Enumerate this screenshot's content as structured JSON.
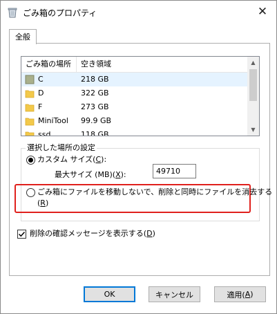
{
  "window": {
    "title": "ごみ箱のプロパティ",
    "close_glyph": "✕"
  },
  "tabs": [
    {
      "label": "全般",
      "selected": true
    }
  ],
  "listview": {
    "columns": [
      "ごみ箱の場所",
      "空き領域"
    ],
    "rows": [
      {
        "name": "C",
        "size": "218 GB",
        "icon": "drive-icon",
        "selected": true
      },
      {
        "name": "D",
        "size": "322 GB",
        "icon": "folder-icon",
        "selected": false
      },
      {
        "name": "F",
        "size": "273 GB",
        "icon": "folder-icon",
        "selected": false
      },
      {
        "name": "MiniTool",
        "size": "99.9 GB",
        "icon": "folder-icon",
        "selected": false
      },
      {
        "name": "ssd",
        "size": "118 GB",
        "icon": "folder-icon",
        "selected": false
      }
    ]
  },
  "settings": {
    "group_title": "選択した場所の設定",
    "custom_size_label": "カスタム サイズ(",
    "custom_size_key": "C",
    "custom_size_suffix": "):",
    "max_size_label": "最大サイズ (MB)(",
    "max_size_key": "X",
    "max_size_suffix": "):",
    "max_size_value": "49710",
    "delete_immediately_label": "ごみ箱にファイルを移動しないで、削除と同時にファイルを消去する",
    "delete_immediately_key_open": "(",
    "delete_immediately_key": "R",
    "delete_immediately_key_close": ")"
  },
  "confirm": {
    "label": "削除の確認メッセージを表示する(",
    "key": "D",
    "suffix": ")",
    "checked": true
  },
  "buttons": {
    "ok": "OK",
    "cancel": "キャンセル",
    "apply_label": "適用(",
    "apply_key": "A",
    "apply_suffix": ")"
  },
  "colors": {
    "highlight": "#e0201c",
    "selection": "#e5f3ff",
    "folder": "#f3c94a",
    "drive": "#a9b08c",
    "default_button_border": "#0078d7"
  }
}
